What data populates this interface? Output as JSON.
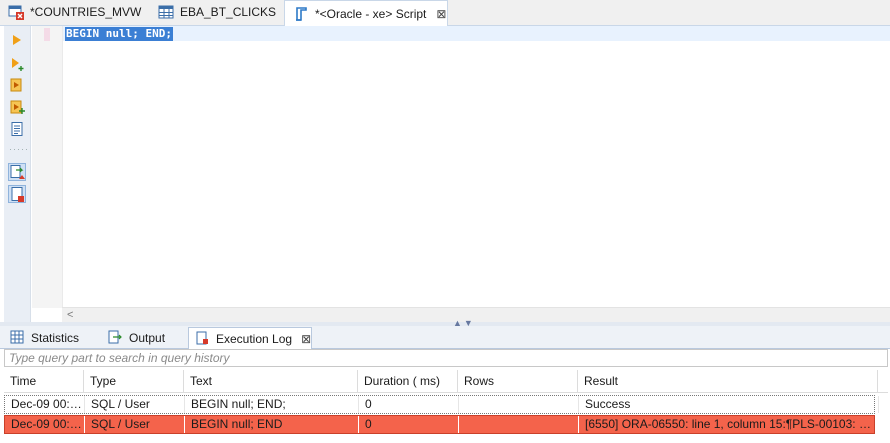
{
  "editor_tabs": [
    {
      "label": "*COUNTRIES_MVW",
      "icon": "materialized-view-error-icon"
    },
    {
      "label": "EBA_BT_CLICKS",
      "icon": "table-icon"
    },
    {
      "label": "*<Oracle - xe> Script",
      "icon": "script-icon",
      "active": true,
      "close": "⊠"
    }
  ],
  "editor": {
    "code": "BEGIN null; END;",
    "toolbar": [
      "execute-statement-icon",
      "execute-statement-new-tab-icon",
      "execute-script-icon",
      "execute-script-new-tab-icon",
      "explain-plan-icon",
      "show-server-output-icon",
      "show-execution-log-icon"
    ],
    "scroll_left": "<"
  },
  "panel_tabs": [
    {
      "label": "Statistics",
      "icon": "statistics-icon"
    },
    {
      "label": "Output",
      "icon": "output-icon"
    },
    {
      "label": "Execution Log",
      "icon": "execution-log-icon",
      "active": true,
      "close": "⊠"
    }
  ],
  "search": {
    "placeholder": "Type query part to search in query history",
    "value": ""
  },
  "log_table": {
    "columns": [
      "Time",
      "Type",
      "Text",
      "Duration ( ms)",
      "Rows",
      "Result"
    ],
    "rows": [
      [
        "Dec-09 00:2...",
        "SQL / User",
        "BEGIN null; END;",
        "0",
        "",
        "Success"
      ],
      [
        "Dec-09 00:2...",
        "SQL / User",
        "BEGIN null; END",
        "0",
        "",
        "[6550] ORA-06550: line 1, column 15:¶PLS-00103: En..."
      ]
    ]
  },
  "colors": {
    "error_row": "#f4634b",
    "selection": "#3b7fd4",
    "current_line": "#e8f2fe"
  }
}
